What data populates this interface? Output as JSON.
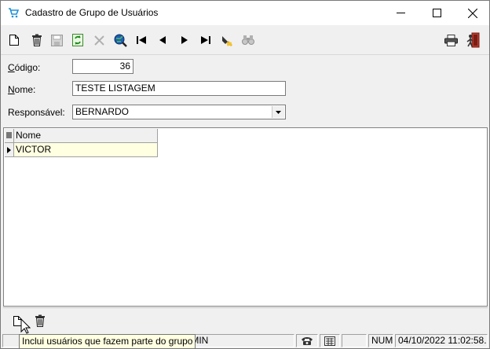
{
  "window": {
    "title": "Cadastro de Grupo de Usuários",
    "controls": {
      "minimize": "—",
      "maximize": "☐",
      "close": "✕"
    }
  },
  "toolbar": {
    "buttons": [
      {
        "name": "new-record",
        "icon": "new-document-icon"
      },
      {
        "name": "delete-record",
        "icon": "trash-icon"
      },
      {
        "name": "save-record",
        "icon": "save-icon",
        "enabled": false
      },
      {
        "name": "refresh",
        "icon": "refresh-icon"
      },
      {
        "name": "cancel",
        "icon": "cancel-icon",
        "enabled": false
      },
      {
        "name": "search",
        "icon": "search-globe-icon"
      },
      {
        "name": "first",
        "icon": "first-record-icon"
      },
      {
        "name": "previous",
        "icon": "previous-record-icon"
      },
      {
        "name": "next",
        "icon": "next-record-icon"
      },
      {
        "name": "last",
        "icon": "last-record-icon"
      },
      {
        "name": "clear-filter",
        "icon": "eraser-icon"
      },
      {
        "name": "find",
        "icon": "binoculars-icon",
        "enabled": false
      },
      {
        "name": "print",
        "icon": "printer-icon"
      },
      {
        "name": "exit",
        "icon": "exit-door-icon"
      }
    ]
  },
  "form": {
    "codigo": {
      "label_first": "C",
      "label_rest": "ódigo:",
      "value": "36"
    },
    "nome": {
      "label_first": "N",
      "label_rest": "ome:",
      "value": "TESTE LISTAGEM"
    },
    "responsavel": {
      "label": "Responsável:",
      "value": "BERNARDO"
    }
  },
  "grid": {
    "columns": [
      "Nome"
    ],
    "rows": [
      [
        "VICTOR"
      ]
    ]
  },
  "bottom_actions": {
    "tooltip": "Inclui usuários que fazem parte do grupo"
  },
  "statusbar": {
    "user_fragment": "o: ADMIN",
    "num": "NUM",
    "datetime": "04/10/2022 11:02:58..."
  },
  "colors": {
    "grid_row_highlight": "#ffffe1",
    "window_bg": "#f0f0f0",
    "tooltip_bg": "#ffffe1"
  }
}
